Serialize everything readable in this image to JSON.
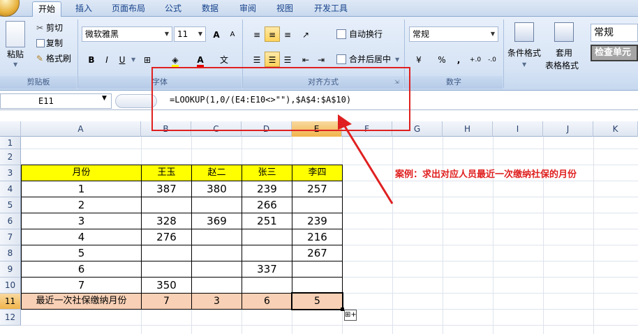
{
  "tabs": [
    "开始",
    "插入",
    "页面布局",
    "公式",
    "数据",
    "审阅",
    "视图",
    "开发工具"
  ],
  "clipboard": {
    "paste": "粘贴",
    "cut": "剪切",
    "copy": "复制",
    "format_painter": "格式刷",
    "group": "剪贴板"
  },
  "font": {
    "name": "微软雅黑",
    "size": "11",
    "group": "字体",
    "bold": "B",
    "italic": "I",
    "underline": "U",
    "grow": "A",
    "shrink": "A",
    "color_a": "A",
    "wen": "文"
  },
  "alignment": {
    "wrap": "自动换行",
    "merge": "合并后居中",
    "group": "对齐方式"
  },
  "number": {
    "format": "常规",
    "group": "数字",
    "percent": "%",
    "comma": ",",
    "inc_dec": "+.0",
    "dec_dec": "-.0"
  },
  "styles": {
    "conditional": "条件格式",
    "table_line1": "套用",
    "table_line2": "表格格式",
    "style_normal": "常规",
    "style_check": "检查单元"
  },
  "formula_bar": {
    "name_box": "E11",
    "formula": "=LOOKUP(1,0/(E4:E10<>\"\"),$A$4:$A$10)"
  },
  "columns": [
    "A",
    "B",
    "C",
    "D",
    "E",
    "F",
    "G",
    "H",
    "I",
    "J",
    "K"
  ],
  "rows": [
    "1",
    "2",
    "3",
    "4",
    "5",
    "6",
    "7",
    "8",
    "9",
    "10",
    "11",
    "12"
  ],
  "table": {
    "header": [
      "月份",
      "王玉",
      "赵二",
      "张三",
      "李四"
    ],
    "data": [
      [
        "1",
        "387",
        "380",
        "239",
        "257"
      ],
      [
        "2",
        "",
        "",
        "266",
        ""
      ],
      [
        "3",
        "328",
        "369",
        "251",
        "239"
      ],
      [
        "4",
        "276",
        "",
        "",
        "216"
      ],
      [
        "5",
        "",
        "",
        "",
        "267"
      ],
      [
        "6",
        "",
        "",
        "337",
        ""
      ],
      [
        "7",
        "350",
        "",
        "",
        ""
      ]
    ],
    "result": [
      "最近一次社保缴纳月份",
      "7",
      "3",
      "6",
      "5"
    ]
  },
  "annotation": "案例：求出对应人员最近一次缴纳社保的月份",
  "colors": {
    "header_fill": "#ffff00",
    "result_fill": "#f8d0b5",
    "accent_red": "#e02020"
  }
}
